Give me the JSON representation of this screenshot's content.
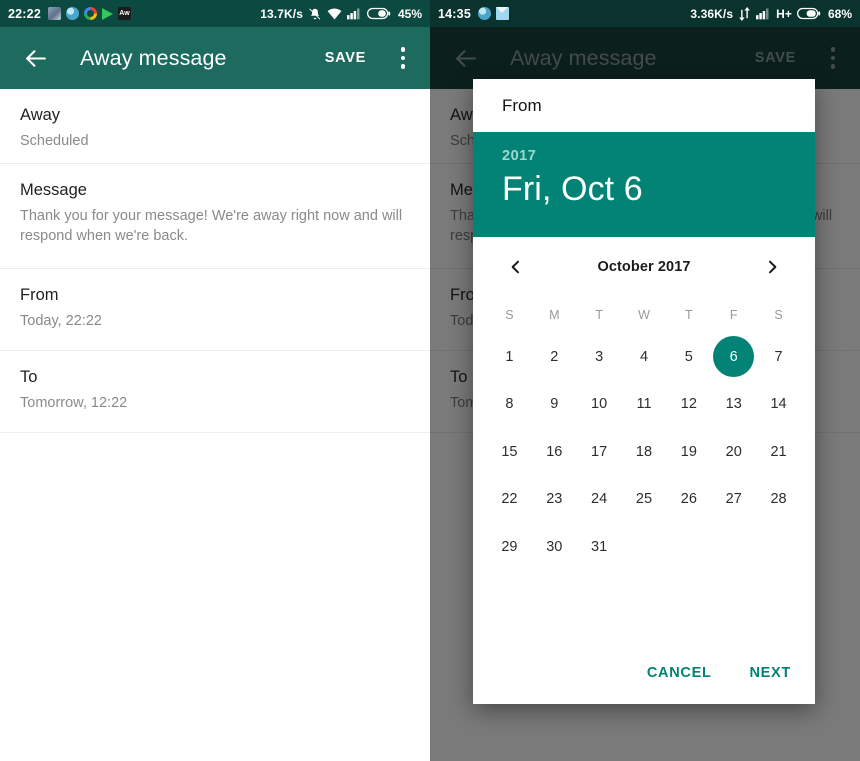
{
  "colors": {
    "status_bar": "#0c4a41",
    "app_bar": "#1d6b5e",
    "accent_teal": "#038375",
    "dialog_action": "#018275",
    "scrim": "rgba(0,0,0,0.52)"
  },
  "left_screen": {
    "status_bar": {
      "clock": "22:22",
      "network_speed": "13.7K/s",
      "battery_percent": "45%",
      "left_icons": [
        "gallery-icon",
        "browser-icon",
        "google-icon",
        "play-store-icon",
        "app-icon"
      ],
      "right_icons": [
        "mute-icon",
        "wifi-icon",
        "signal-icon",
        "battery-icon"
      ]
    },
    "app_bar": {
      "back_icon": "back-arrow-icon",
      "title": "Away message",
      "save_label": "SAVE",
      "overflow_icon": "more-vertical-icon"
    },
    "rows": [
      {
        "title": "Away",
        "subtitle": "Scheduled"
      },
      {
        "title": "Message",
        "subtitle": "Thank you for your message! We're away right now and will respond when we're back."
      },
      {
        "title": "From",
        "subtitle": "Today, 22:22"
      },
      {
        "title": "To",
        "subtitle": "Tomorrow, 12:22"
      }
    ]
  },
  "right_screen": {
    "status_bar": {
      "clock": "14:35",
      "network_speed": "3.36K/s",
      "network_type": "H+",
      "battery_percent": "68%",
      "left_icons": [
        "browser-icon",
        "mail-icon"
      ],
      "right_icons": [
        "data-transfer-icon",
        "signal-icon",
        "battery-icon"
      ]
    },
    "app_bar": {
      "back_icon": "back-arrow-icon",
      "title": "Away message",
      "save_label": "SAVE",
      "overflow_icon": "more-vertical-icon"
    },
    "rows": [
      {
        "title": "Away",
        "subtitle": "Scheduled"
      },
      {
        "title": "Message",
        "subtitle": "Thank you for your message! We're away right now and will respond when we're back."
      },
      {
        "title": "From",
        "subtitle": "Today, 22:22"
      },
      {
        "title": "To",
        "subtitle": "Tomorrow, 12:22"
      }
    ],
    "date_picker": {
      "label": "From",
      "year": "2017",
      "selected_date_text": "Fri, Oct 6",
      "prev_icon": "chevron-left-icon",
      "next_icon": "chevron-right-icon",
      "month_label": "October 2017",
      "weekday_headers": [
        "S",
        "M",
        "T",
        "W",
        "T",
        "F",
        "S"
      ],
      "leading_blanks": 0,
      "days": [
        1,
        2,
        3,
        4,
        5,
        6,
        7,
        8,
        9,
        10,
        11,
        12,
        13,
        14,
        15,
        16,
        17,
        18,
        19,
        20,
        21,
        22,
        23,
        24,
        25,
        26,
        27,
        28,
        29,
        30,
        31
      ],
      "selected_day": 6,
      "cancel_label": "CANCEL",
      "next_label": "NEXT"
    }
  }
}
